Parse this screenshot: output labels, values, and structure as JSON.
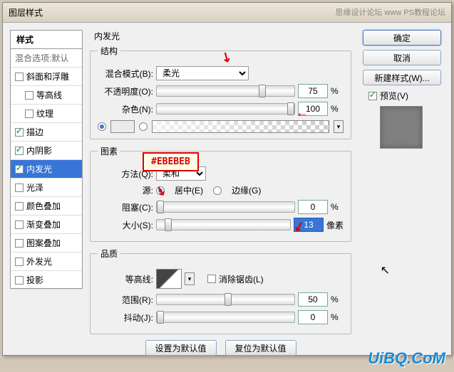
{
  "titlebar": {
    "title": "图层样式",
    "credits": "思缘设计论坛  www PS教程论坛"
  },
  "left": {
    "header": "样式",
    "blend_default": "混合选项:默认",
    "items": [
      {
        "label": "斜面和浮雕",
        "checked": false
      },
      {
        "label": "等高线",
        "checked": false,
        "indent": true
      },
      {
        "label": "纹理",
        "checked": false,
        "indent": true
      },
      {
        "label": "描边",
        "checked": true
      },
      {
        "label": "内阴影",
        "checked": true
      },
      {
        "label": "内发光",
        "checked": true,
        "selected": true
      },
      {
        "label": "光泽",
        "checked": false
      },
      {
        "label": "颜色叠加",
        "checked": false
      },
      {
        "label": "渐变叠加",
        "checked": false
      },
      {
        "label": "图案叠加",
        "checked": false
      },
      {
        "label": "外发光",
        "checked": false
      },
      {
        "label": "投影",
        "checked": false
      }
    ]
  },
  "center": {
    "title": "内发光",
    "structure": {
      "legend": "结构",
      "blend_mode_label": "混合模式(B):",
      "blend_mode_value": "柔光",
      "opacity_label": "不透明度(O):",
      "opacity_value": "75",
      "noise_label": "杂色(N):",
      "noise_value": "100",
      "pct": "%"
    },
    "elements": {
      "legend": "图素",
      "method_label": "方法(Q):",
      "method_value": "柔和",
      "source_label": "源:",
      "source_center": "居中(E)",
      "source_edge": "边缘(G)",
      "choke_label": "阻塞(C):",
      "choke_value": "0",
      "size_label": "大小(S):",
      "size_value": "13",
      "size_unit": "像素",
      "pct": "%"
    },
    "quality": {
      "legend": "品质",
      "contour_label": "等高线:",
      "antialias_label": "消除锯齿(L)",
      "range_label": "范围(R):",
      "range_value": "50",
      "jitter_label": "抖动(J):",
      "jitter_value": "0",
      "pct": "%"
    },
    "make_default": "设置为默认值",
    "reset_default": "复位为默认值"
  },
  "right": {
    "ok": "确定",
    "cancel": "取消",
    "new_style": "新建样式(W)...",
    "preview": "预览(V)"
  },
  "annot": {
    "hex": "#EBEBEB",
    "watermark": "UiBQ.CoM"
  }
}
